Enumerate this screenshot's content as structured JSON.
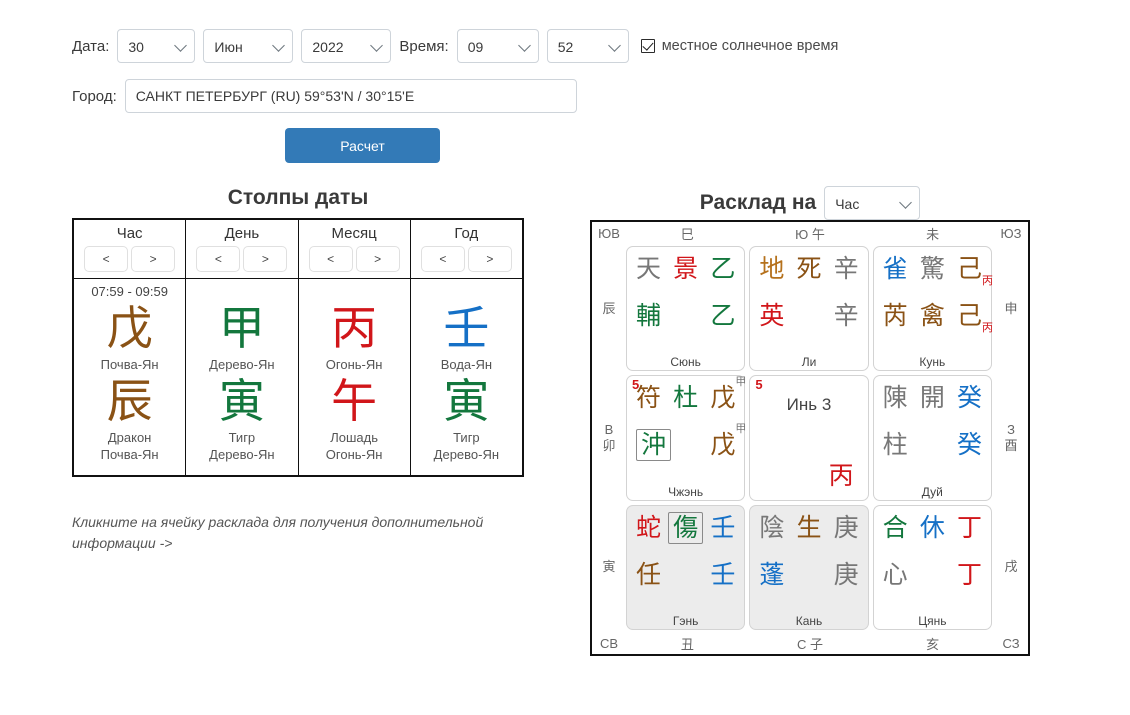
{
  "form": {
    "date_label": "Дата:",
    "day": "30",
    "month": "Июн",
    "year": "2022",
    "time_label": "Время:",
    "hour": "09",
    "minute": "52",
    "solar_time_label": "местное солнечное время",
    "city_label": "Город:",
    "city_value": "САНКТ ПЕТЕРБУРГ (RU) 59°53'N / 30°15'E",
    "calc_button": "Расчет"
  },
  "pillars": {
    "title": "Столпы даты",
    "nav_prev": "<",
    "nav_next": ">",
    "columns": [
      {
        "title": "Час",
        "time_range": "07:59 - 09:59",
        "stem": "戊",
        "stem_color": "#8a5215",
        "stem_desc": "Почва-Ян",
        "branch": "辰",
        "branch_color": "#8a5215",
        "branch_animal": "Дракон",
        "branch_desc": "Почва-Ян"
      },
      {
        "title": "День",
        "time_range": "",
        "stem": "甲",
        "stem_color": "#13773d",
        "stem_desc": "Дерево-Ян",
        "branch": "寅",
        "branch_color": "#13773d",
        "branch_animal": "Тигр",
        "branch_desc": "Дерево-Ян"
      },
      {
        "title": "Месяц",
        "time_range": "",
        "stem": "丙",
        "stem_color": "#d1161a",
        "stem_desc": "Огонь-Ян",
        "branch": "午",
        "branch_color": "#d1161a",
        "branch_animal": "Лошадь",
        "branch_desc": "Огонь-Ян"
      },
      {
        "title": "Год",
        "time_range": "",
        "stem": "壬",
        "stem_color": "#1570c6",
        "stem_desc": "Вода-Ян",
        "branch": "寅",
        "branch_color": "#13773d",
        "branch_animal": "Тигр",
        "branch_desc": "Дерево-Ян"
      }
    ],
    "hint": "Кликните на ячейку расклада для получения дополнительной информации ->"
  },
  "qimen": {
    "title": "Расклад на",
    "period_select": "Час",
    "edges": {
      "top": [
        "ЮВ",
        "巳",
        "Ю 午",
        "未",
        "ЮЗ"
      ],
      "bottom": [
        "СВ",
        "丑",
        "С 子",
        "亥",
        "СЗ"
      ],
      "left": [
        "辰",
        "В\n卯",
        "寅"
      ],
      "left_cells": [
        {
          "lat": "",
          "branch": "辰"
        },
        {
          "lat": "В",
          "branch": "卯"
        },
        {
          "lat": "",
          "branch": "寅"
        }
      ],
      "right_cells": [
        {
          "lat": "",
          "branch": "申"
        },
        {
          "lat": "З",
          "branch": "酉"
        },
        {
          "lat": "",
          "branch": "戌"
        }
      ]
    },
    "cells": [
      {
        "palace": "Сюнь",
        "shaded": false,
        "badge": "",
        "top": [
          {
            "ch": "天",
            "color": "#777",
            "boxed": false
          },
          {
            "ch": "景",
            "color": "#d1161a",
            "boxed": false
          },
          {
            "ch": "乙",
            "color": "#13773d",
            "boxed": false
          }
        ],
        "bottom": [
          {
            "ch": "輔",
            "color": "#13773d",
            "boxed": false
          },
          {
            "ch": "",
            "color": "",
            "boxed": false
          },
          {
            "ch": "乙",
            "color": "#13773d",
            "boxed": false
          }
        ]
      },
      {
        "palace": "Ли",
        "shaded": false,
        "badge": "",
        "top": [
          {
            "ch": "地",
            "color": "#b5711c",
            "boxed": false
          },
          {
            "ch": "死",
            "color": "#8a5215",
            "boxed": false
          },
          {
            "ch": "辛",
            "color": "#777",
            "boxed": false
          }
        ],
        "bottom": [
          {
            "ch": "英",
            "color": "#d1161a",
            "boxed": false
          },
          {
            "ch": "",
            "color": "",
            "boxed": false
          },
          {
            "ch": "辛",
            "color": "#777",
            "boxed": false
          }
        ]
      },
      {
        "palace": "Кунь",
        "shaded": false,
        "badge": "",
        "top": [
          {
            "ch": "雀",
            "color": "#1570c6",
            "boxed": false
          },
          {
            "ch": "驚",
            "color": "#777",
            "boxed": false
          },
          {
            "ch": "己",
            "color": "#8a5215",
            "boxed": false,
            "sub": "丙",
            "sub_color": "#d1161a"
          }
        ],
        "bottom": [
          {
            "ch": "芮",
            "color": "#8a5215",
            "boxed": false
          },
          {
            "ch": "禽",
            "color": "#8a5215",
            "boxed": false
          },
          {
            "ch": "己",
            "color": "#8a5215",
            "boxed": false,
            "sub": "丙",
            "sub_color": "#d1161a"
          }
        ]
      },
      {
        "palace": "Чжэнь",
        "shaded": false,
        "badge": "5",
        "top": [
          {
            "ch": "符",
            "color": "#8a5215",
            "boxed": false
          },
          {
            "ch": "杜",
            "color": "#13773d",
            "boxed": false
          },
          {
            "ch": "戊",
            "color": "#8a5215",
            "boxed": false,
            "sup": "甲",
            "sup_color": "#777"
          }
        ],
        "bottom": [
          {
            "ch": "沖",
            "color": "#13773d",
            "boxed": true
          },
          {
            "ch": "",
            "color": "",
            "boxed": false
          },
          {
            "ch": "戊",
            "color": "#8a5215",
            "boxed": false,
            "sup": "甲",
            "sup_color": "#777"
          }
        ]
      },
      {
        "palace": "",
        "shaded": false,
        "badge": "5",
        "is_center": true,
        "center_text": "Инь 3",
        "center_glyph": "丙",
        "center_glyph_color": "#d1161a"
      },
      {
        "palace": "Дуй",
        "shaded": false,
        "badge": "",
        "top": [
          {
            "ch": "陳",
            "color": "#777",
            "boxed": false
          },
          {
            "ch": "開",
            "color": "#777",
            "boxed": false
          },
          {
            "ch": "癸",
            "color": "#1570c6",
            "boxed": false
          }
        ],
        "bottom": [
          {
            "ch": "柱",
            "color": "#777",
            "boxed": false
          },
          {
            "ch": "",
            "color": "",
            "boxed": false
          },
          {
            "ch": "癸",
            "color": "#1570c6",
            "boxed": false
          }
        ]
      },
      {
        "palace": "Гэнь",
        "shaded": true,
        "badge": "",
        "top": [
          {
            "ch": "蛇",
            "color": "#d1161a",
            "boxed": false
          },
          {
            "ch": "傷",
            "color": "#13773d",
            "boxed": true
          },
          {
            "ch": "壬",
            "color": "#1570c6",
            "boxed": false
          }
        ],
        "bottom": [
          {
            "ch": "任",
            "color": "#8a5215",
            "boxed": false
          },
          {
            "ch": "",
            "color": "",
            "boxed": false
          },
          {
            "ch": "壬",
            "color": "#1570c6",
            "boxed": false
          }
        ]
      },
      {
        "palace": "Кань",
        "shaded": true,
        "badge": "",
        "top": [
          {
            "ch": "陰",
            "color": "#777",
            "boxed": false
          },
          {
            "ch": "生",
            "color": "#8a5215",
            "boxed": false
          },
          {
            "ch": "庚",
            "color": "#777",
            "boxed": false
          }
        ],
        "bottom": [
          {
            "ch": "蓬",
            "color": "#1570c6",
            "boxed": false
          },
          {
            "ch": "",
            "color": "",
            "boxed": false
          },
          {
            "ch": "庚",
            "color": "#777",
            "boxed": false
          }
        ]
      },
      {
        "palace": "Цянь",
        "shaded": false,
        "badge": "",
        "top": [
          {
            "ch": "合",
            "color": "#13773d",
            "boxed": false
          },
          {
            "ch": "休",
            "color": "#1570c6",
            "boxed": false
          },
          {
            "ch": "丁",
            "color": "#d1161a",
            "boxed": false
          }
        ],
        "bottom": [
          {
            "ch": "心",
            "color": "#777",
            "boxed": false
          },
          {
            "ch": "",
            "color": "",
            "boxed": false
          },
          {
            "ch": "丁",
            "color": "#d1161a",
            "boxed": false
          }
        ]
      }
    ]
  },
  "colors": {
    "accent": "#337ab7",
    "wood": "#13773d",
    "fire": "#d1161a",
    "earth": "#8a5215",
    "metal": "#777777",
    "water": "#1570c6"
  }
}
